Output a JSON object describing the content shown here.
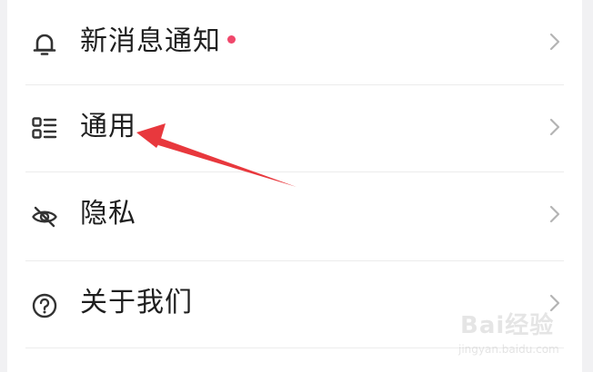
{
  "settings": {
    "items": [
      {
        "label": "新消息通知",
        "icon": "bell-icon",
        "has_badge_dot": true
      },
      {
        "label": "通用",
        "icon": "general-list-icon",
        "has_badge_dot": false
      },
      {
        "label": "隐私",
        "icon": "eye-off-icon",
        "has_badge_dot": false
      },
      {
        "label": "关于我们",
        "icon": "question-circle-icon",
        "has_badge_dot": false
      }
    ]
  },
  "colors": {
    "badge_dot": "#f0476b",
    "annotation_arrow": "#e8383d",
    "text": "#1f1f1f",
    "chevron": "#b4b4b4",
    "icon": "#333333"
  },
  "watermark": {
    "logo_text": "Bai经验",
    "domain": "jingyan.baidu.com"
  }
}
